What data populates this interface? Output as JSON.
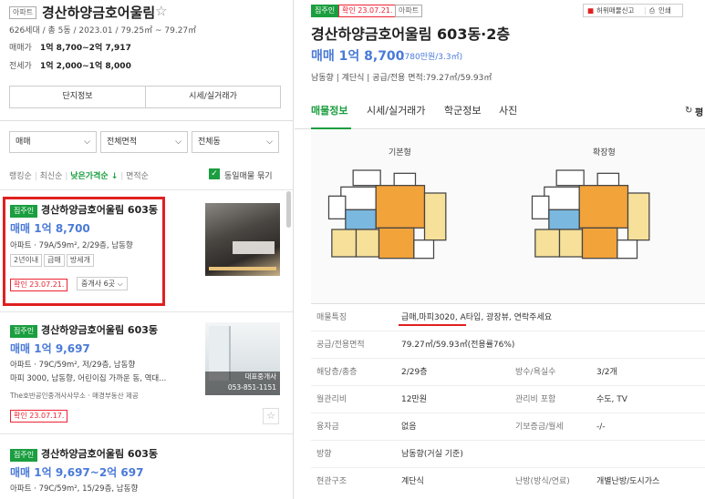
{
  "left": {
    "type_tag": "아파트",
    "complex_name": "경산하양금호어울림",
    "star": "☆",
    "meta": "626세대 / 총 5동 / 2023.01 / 79.25㎡ ~ 79.27㎡",
    "sale_label": "매매가",
    "sale_value": "1억 8,700~2억 7,917",
    "jeonse_label": "전세가",
    "jeonse_value": "1억 2,000~1억 8,000",
    "btn_info": "단지정보",
    "btn_price": "시세/실거래가",
    "filters": [
      "매매",
      "전체면적",
      "전체동"
    ],
    "sorts": [
      "랭킹순",
      "최신순",
      "낮은가격순 ↓",
      "면적순"
    ],
    "same_listing": "동일매물 묶기",
    "listings": [
      {
        "badge": "집주인",
        "title": "경산하양금호어울림 603동",
        "price": "매매 1억 8,700",
        "spec": "아파트 · 79A/59m², 2/29층, 남동향",
        "chips": [
          "2년이내",
          "급매",
          "방세개"
        ],
        "confirm": "확인 23.07.21.",
        "agents": "중개사 6곳"
      },
      {
        "badge": "집주인",
        "title": "경산하양금호어울림 603동",
        "price": "매매 1억 9,697",
        "spec": "아파트 · 79C/59m², 저/29층, 남동향",
        "desc": "마피 3000, 남동향, 어린이집 가까운 동, 역대...",
        "agency": "The호반공인중개사사무소 · 매경부동산 제공",
        "confirm": "확인 23.07.17.",
        "thumb_text": "대표중개사\n053-851-1151"
      },
      {
        "badge": "집주인",
        "title": "경산하양금호어울림 603동",
        "price": "매매 1억 9,697~2억 697",
        "spec": "아파트 · 79C/59m², 15/29층, 남동향"
      }
    ]
  },
  "right": {
    "badge": "집주인",
    "confirm": "확인 23.07.21.",
    "type_tag": "아파트",
    "report": "허위매물신고",
    "print": "인쇄",
    "title": "경산하양금호어울림 603동·2층",
    "price_main": "매매 1억 8,700",
    "price_sub": "(780만원/3.3㎡)",
    "summary": "남동향 | 계단식 | 공급/전용 면적:79.27㎡/59.93㎡",
    "tabs": [
      "매물정보",
      "시세/실거래가",
      "학군정보",
      "사진"
    ],
    "refresh": "평",
    "plan_basic": "기본형",
    "plan_ext": "확장형",
    "rows": [
      {
        "k": "매물특징",
        "v": "급매,마피3020, A타입, 광장뷰, 연락주세요"
      },
      {
        "k": "공급/전용면적",
        "v": "79.27㎡/59.93㎡(전용률76%)"
      },
      {
        "k": "해당층/총층",
        "v": "2/29층",
        "k2": "방수/욕실수",
        "v2": "3/2개"
      },
      {
        "k": "월관리비",
        "v": "12만원",
        "k2": "관리비 포함",
        "v2": "수도, TV"
      },
      {
        "k": "융자금",
        "v": "없음",
        "k2": "기보증금/월세",
        "v2": "-/-"
      },
      {
        "k": "방향",
        "v": "남동향(거실 기준)"
      },
      {
        "k": "현관구조",
        "v": "계단식",
        "k2": "난방(방식/연료)",
        "v2": "개별난방/도시가스"
      }
    ]
  },
  "colors": {
    "accent_blue": "#4a7ad8",
    "green": "#1a9e3f",
    "red": "#e02020"
  }
}
